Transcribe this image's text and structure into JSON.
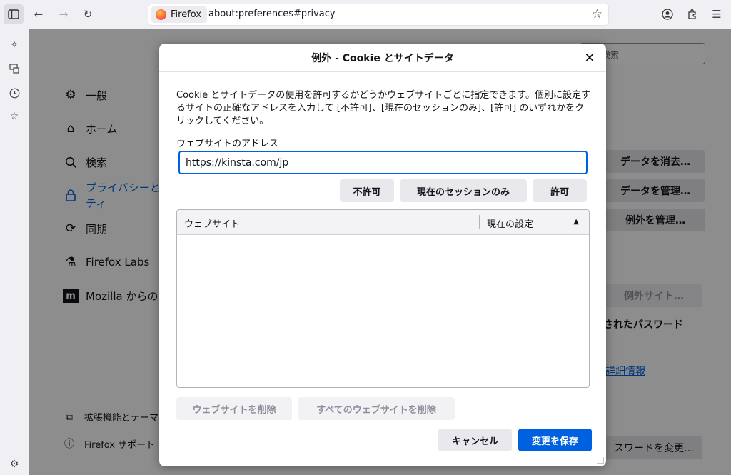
{
  "browser": {
    "identity_label": "Firefox",
    "url": "about:preferences#privacy"
  },
  "prefs": {
    "categories": [
      {
        "label": "一般",
        "icon": "gear-icon"
      },
      {
        "label": "ホーム",
        "icon": "home-icon"
      },
      {
        "label": "検索",
        "icon": "search-icon"
      },
      {
        "label": "プライバシーとセキュリティ",
        "line1": "プライバシーと",
        "line2": "ティ",
        "icon": "lock-icon"
      },
      {
        "label": "同期",
        "icon": "sync-icon"
      },
      {
        "label": "Firefox Labs",
        "icon": "flask-icon"
      },
      {
        "label": "Mozilla からの",
        "icon": "mozilla-icon"
      }
    ],
    "footer": [
      {
        "label": "拡張機能とテーマ",
        "icon": "puzzle-icon"
      },
      {
        "label": "Firefox サポート",
        "icon": "help-icon"
      }
    ],
    "search_placeholder": "検索",
    "buttons": {
      "clear_data": "データを消去…",
      "manage_data": "データを管理…",
      "manage_exceptions": "例外を管理…",
      "exceptions_sites": "例外サイト…",
      "saved_passwords": "されたパスワード",
      "change_password": "スワードを変更…"
    },
    "learn_more": "詳細情報"
  },
  "dialog": {
    "title": "例外 - Cookie とサイトデータ",
    "description": "Cookie とサイトデータの使用を許可するかどうかウェブサイトごとに指定できます。個別に設定するサイトの正確なアドレスを入力して [不許可]、[現在のセッションのみ]、[許可] のいずれかをクリックしてください。",
    "address_label": "ウェブサイトのアドレス",
    "address_value": "https://kinsta.com/jp",
    "block_label": "不許可",
    "session_label": "現在のセッションのみ",
    "allow_label": "許可",
    "table": {
      "col_site": "ウェブサイト",
      "col_status": "現在の設定",
      "rows": []
    },
    "remove_site_label": "ウェブサイトを削除",
    "remove_all_label": "すべてのウェブサイトを削除",
    "cancel_label": "キャンセル",
    "save_label": "変更を保存"
  },
  "colors": {
    "accent": "#0061e0",
    "overlay": "rgba(0,0,0,0.44)"
  }
}
